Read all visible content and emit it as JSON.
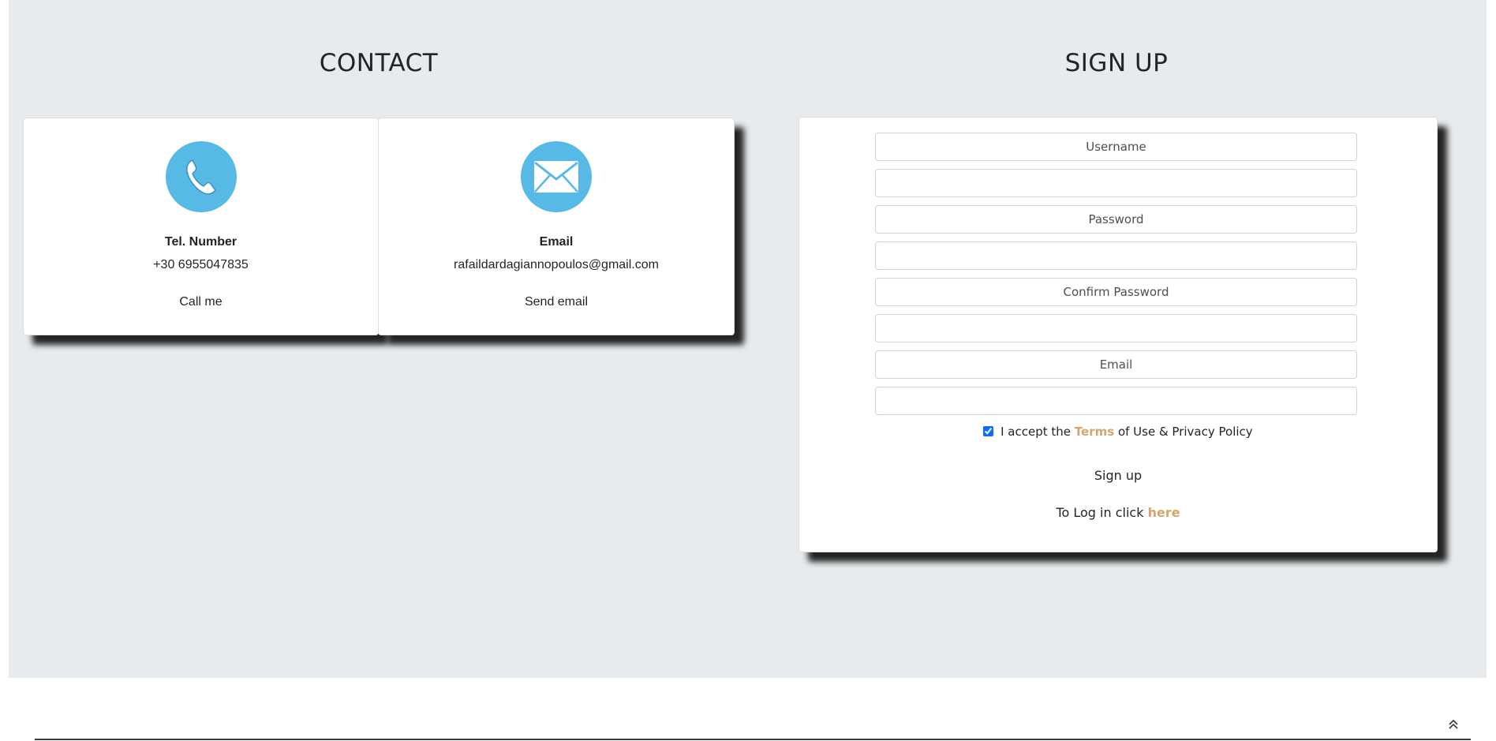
{
  "contact": {
    "title": "CONTACT",
    "phone": {
      "icon": "phone-icon",
      "label": "Tel. Number",
      "value": "+30 6955047835",
      "action": "Call me"
    },
    "email": {
      "icon": "envelope-icon",
      "label": "Email",
      "value": "rafaildardagiannopoulos@gmail.com",
      "action": "Send email"
    }
  },
  "signup": {
    "title": "SIGN UP",
    "fields": [
      {
        "label": "Username",
        "value": ""
      },
      {
        "label": "Password",
        "value": ""
      },
      {
        "label": "Confirm Password",
        "value": ""
      },
      {
        "label": "Email",
        "value": ""
      }
    ],
    "terms": {
      "checked": true,
      "prefix": "I accept the",
      "link": "Terms",
      "suffix": "of Use & Privacy Policy"
    },
    "submit_label": "Sign up",
    "login": {
      "prefix": "To Log in click",
      "link": "here"
    }
  },
  "colors": {
    "panel_bg": "#e8ebee",
    "icon_bg": "#57b9e6",
    "accent": "#d4a66d"
  },
  "scroll_top_icon": "double-chevron-up-icon"
}
